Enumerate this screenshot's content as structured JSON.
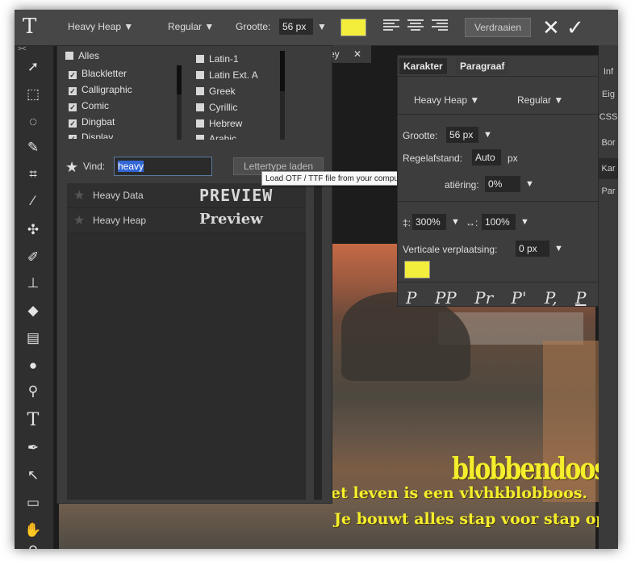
{
  "topbar": {
    "font_name": "Heavy Heap ▼",
    "font_style": "Regular ▼",
    "size_label": "Grootte:",
    "size_value": "56 px",
    "size_arrow": "▼",
    "rotate_label": "Verdraaien",
    "cancel_glyph": "✕",
    "confirm_glyph": "✓",
    "text_color": "#f2ee3b"
  },
  "font_dialog": {
    "all_label": "Alles",
    "categories_left": [
      {
        "label": "Blackletter",
        "checked": true
      },
      {
        "label": "Calligraphic",
        "checked": true
      },
      {
        "label": "Comic",
        "checked": true
      },
      {
        "label": "Dingbat",
        "checked": true
      },
      {
        "label": "Display",
        "checked": true
      }
    ],
    "categories_right": [
      {
        "label": "Latin-1"
      },
      {
        "label": "Latin Ext. A"
      },
      {
        "label": "Greek"
      },
      {
        "label": "Cyrillic"
      },
      {
        "label": "Hebrew"
      },
      {
        "label": "Arabic"
      }
    ],
    "find_label": "Vind:",
    "find_value": "heavy",
    "load_button": "Lettertype laden",
    "fonts": [
      {
        "name": "Heavy Data",
        "preview": "PREVIEW"
      },
      {
        "name": "Heavy Heap",
        "preview": "Preview"
      }
    ]
  },
  "tooltip": "Load OTF / TTF file from your computer",
  "canvas_tab": {
    "label": "ey",
    "close": "✕"
  },
  "char_panel": {
    "tab_character": "Karakter",
    "tab_paragraph": "Paragraaf",
    "font_name": "Heavy Heap ▼",
    "font_style": "Regular ▼",
    "size_label": "Grootte:",
    "size_value": "56 px",
    "leading_label": "Regelafstand:",
    "leading_value": "Auto",
    "leading_unit": "px",
    "tracking_label": "atiëring:",
    "tracking_value": "0%",
    "vscale_label": "‡:",
    "vscale_value": "300%",
    "hscale_label": "↔:",
    "hscale_value": "100%",
    "baseline_label": "Verticale verplaatsing:",
    "baseline_value": "0 px",
    "color": "#f2ee3b",
    "styles": [
      "P",
      "PP",
      "Pr",
      "P'",
      "P,",
      "P",
      "P"
    ]
  },
  "right_dock": [
    "Inf",
    "Eig",
    "CSS",
    "Bor",
    "Kar",
    "Par"
  ],
  "right_dock_top": "<>",
  "left_dock_top": "><",
  "canvas_texts": {
    "line1": "blobbendoos",
    "line2": "et leven is een vlvhkblobboos.",
    "line3": "Je bouwt alles stap voor stap op"
  }
}
